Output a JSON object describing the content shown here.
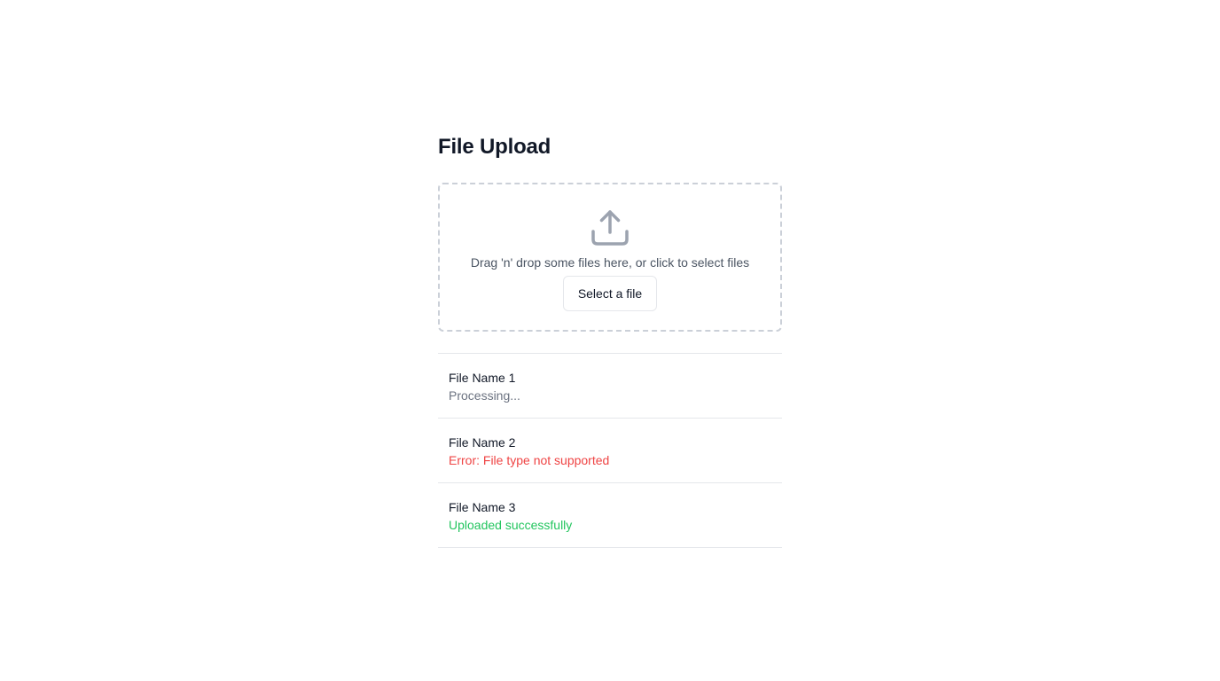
{
  "page": {
    "title": "File Upload"
  },
  "dropzone": {
    "icon": "upload-icon",
    "text": "Drag 'n' drop some files here, or click to select files",
    "button_label": "Select a file"
  },
  "files": [
    {
      "name": "File Name 1",
      "status": "Processing...",
      "state": "processing",
      "status_color": "#6b7280"
    },
    {
      "name": "File Name 2",
      "status": "Error: File type not supported",
      "state": "error",
      "status_color": "#ef4444"
    },
    {
      "name": "File Name 3",
      "status": "Uploaded successfully",
      "state": "success",
      "status_color": "#22c55e"
    }
  ],
  "colors": {
    "text_primary": "#111827",
    "text_secondary": "#4b5563",
    "border": "#e5e7eb",
    "dropzone_border": "#cbd0d8",
    "icon": "#9ca3af"
  }
}
